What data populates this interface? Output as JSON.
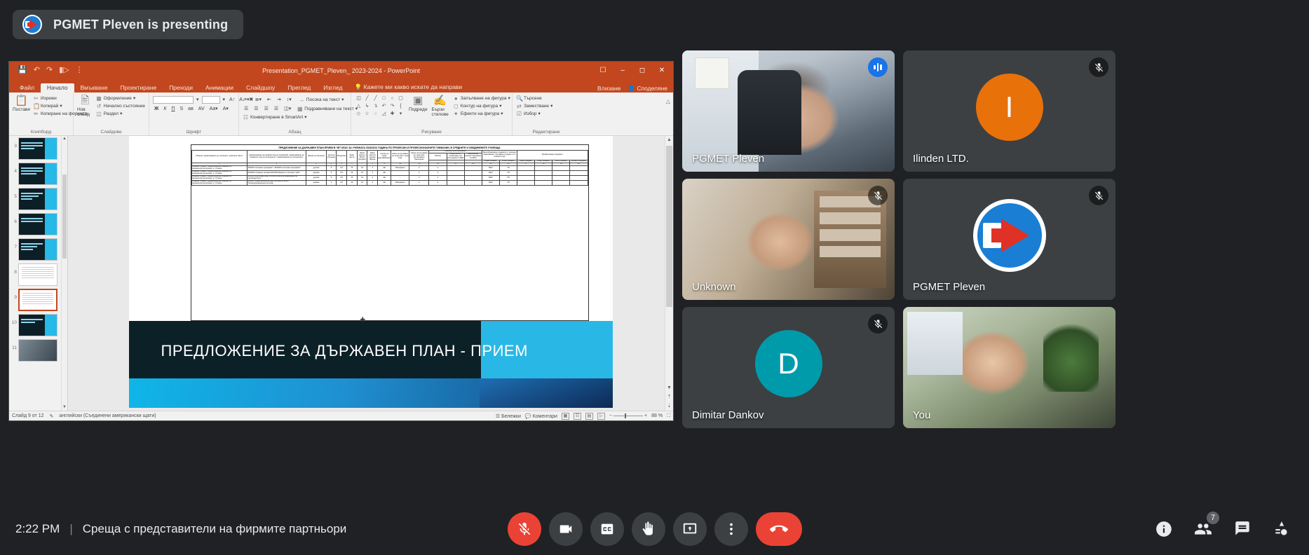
{
  "banner": {
    "text": "PGMET Pleven is presenting",
    "logo_icon": "pgmet-logo-icon"
  },
  "powerpoint": {
    "title": "Presentation_PGMET_Pleven_ 2023-2024 - PowerPoint",
    "quick_access": [
      {
        "name": "save-icon",
        "glyph": "ὋE"
      },
      {
        "name": "undo-icon",
        "glyph": "↶"
      },
      {
        "name": "redo-icon",
        "glyph": "↻"
      },
      {
        "name": "start-slideshow-icon",
        "glyph": "▣"
      },
      {
        "name": "customize-qat-icon",
        "glyph": "☰"
      }
    ],
    "window_buttons": [
      {
        "name": "ribbon-display-options-button",
        "glyph": "❐"
      },
      {
        "name": "minimize-button",
        "glyph": "—"
      },
      {
        "name": "restore-button",
        "glyph": "❐"
      },
      {
        "name": "close-button",
        "glyph": "✕"
      }
    ],
    "tabs": [
      {
        "label": "Файл",
        "active": false
      },
      {
        "label": "Начало",
        "active": true
      },
      {
        "label": "Вмъкване",
        "active": false
      },
      {
        "label": "Проектиране",
        "active": false
      },
      {
        "label": "Преходи",
        "active": false
      },
      {
        "label": "Анимации",
        "active": false
      },
      {
        "label": "Слайдшоу",
        "active": false
      },
      {
        "label": "Преглед",
        "active": false
      },
      {
        "label": "Изглед",
        "active": false
      }
    ],
    "tell_me": "Кажете ми какво искате да направи",
    "tab_right": [
      {
        "label": "Влизане"
      },
      {
        "label": "Споделяне"
      }
    ],
    "ribbon_groups": [
      {
        "label": "Клипборд",
        "big": {
          "label": "Поставя",
          "icon": "paste-icon"
        },
        "items": [
          {
            "label": "Изрежи",
            "icon": "cut-icon"
          },
          {
            "label": "Копирай",
            "icon": "copy-icon"
          },
          {
            "label": "Копиране на форматu",
            "icon": "format-painter-icon"
          }
        ]
      },
      {
        "label": "Слайдове",
        "big": {
          "label": "Нов слайд",
          "icon": "new-slide-icon"
        },
        "items": [
          {
            "label": "Оформление",
            "icon": "layout-icon"
          },
          {
            "label": "Начално състояние",
            "icon": "reset-icon"
          },
          {
            "label": "Раздел",
            "icon": "section-icon"
          }
        ]
      },
      {
        "label": "Шрифт",
        "font_name": "",
        "font_size": "",
        "buttons": [
          "Ж",
          "К",
          "П",
          "S",
          "ав",
          "AV",
          "Aa",
          "A"
        ]
      },
      {
        "label": "Абзац",
        "items": [
          {
            "label": "Посока на текст",
            "icon": "text-direction-icon"
          },
          {
            "label": "Подравняване на текст",
            "icon": "align-text-icon"
          },
          {
            "label": "Конвертиране в SmartArt",
            "icon": "smartart-icon"
          }
        ]
      },
      {
        "label": "Рисуване",
        "items": [
          {
            "label": "Запълване на фигура",
            "icon": "shape-fill-icon"
          },
          {
            "label": "Контур на фигура",
            "icon": "shape-outline-icon"
          },
          {
            "label": "Ефекти на фигура",
            "icon": "shape-effects-icon"
          }
        ],
        "buttons": [
          {
            "label": "Подреди",
            "icon": "arrange-icon"
          },
          {
            "label": "Бързи стилове",
            "icon": "quick-styles-icon"
          }
        ]
      },
      {
        "label": "Редактиране",
        "items": [
          {
            "label": "Търсене",
            "icon": "find-icon"
          },
          {
            "label": "Заместване",
            "icon": "replace-icon"
          },
          {
            "label": "Избор",
            "icon": "select-icon"
          }
        ]
      }
    ],
    "thumbnails": [
      {
        "num": "3",
        "type": "title",
        "selected": false
      },
      {
        "num": "4",
        "type": "title",
        "selected": false
      },
      {
        "num": "5",
        "type": "title",
        "selected": false
      },
      {
        "num": "6",
        "type": "title",
        "selected": false
      },
      {
        "num": "7",
        "type": "title",
        "selected": false
      },
      {
        "num": "8",
        "type": "table",
        "selected": false
      },
      {
        "num": "9",
        "type": "table",
        "selected": true
      },
      {
        "num": "10",
        "type": "table",
        "selected": false
      },
      {
        "num": "11",
        "type": "photo",
        "selected": false
      }
    ],
    "slide": {
      "table_title": "ПРЕДЛОЖЕНИЕ ЗА ДЪРЖАВЕН ПЛАН-ПРИЕМ В ЧЕТ КЛАС ЗА УЧЕБНАТА 2023/2024 ГОДИНА ПО ПРОФЕСИИ И ПРОФЕСИОНАЛНИТЕ ГИМНАЗИИ, В СРЕДНИТЕ И ОБЕДИНЕНИТЕ УЧИЛИЩА",
      "headers_row1": [
        "Община, наименование на училището, населено място",
        "Наименование на профила\nКод на профила/К. наименование на професия;\nКод на специалност; наименование на специалност",
        "Форма на обучение",
        "Срок на обучение",
        "Вход/ниво",
        "Брой места",
        "Брой места в ЗПОО (профил)",
        "Брой места в дуална форма",
        "Степен на проф. квалификация",
        "Ниво на изучаване на чужд език / чужд език",
        "Начин на изучаване на чужд език, Интензивно/ Разширено",
        "Нива на балообразуване",
        "Балообразуващи предмети от основно образование, изучавани в раздел А от учебния план",
        "Профилиращи предмети"
      ],
      "headers_row2": [
        "Избили",
        "Резултати от олимпиади или състезания по БЕЛ",
        "Национално външно оценяване по МОН",
        "първи предмет",
        "втори предмет",
        "първи предмет",
        "втори предмет",
        "трети предмет",
        "четвърти предмет"
      ],
      "col_numbers": [
        "1",
        "2",
        "3",
        "4",
        "5",
        "6",
        "7",
        "8",
        "9",
        "10",
        "11",
        "12",
        "13",
        "14",
        "15",
        "16",
        "17",
        "18",
        "19",
        "20",
        "21",
        "22"
      ],
      "rows": [
        {
          "school": "община Плевен,\nПрофесионална гимназия по механоелектротехника,\nгр. Плевен",
          "profession": "481020 Системен програмист /\n4810201 Системен програмист",
          "form": "дуална",
          "years": "5",
          "entry": "0,5",
          "c6": "13",
          "c7": "13",
          "c8": "3",
          "qual": "АЕ",
          "lang": "Разширено",
          "n1": "2",
          "n2": "2",
          "b1": "БЕЛ",
          "b2": "ТП"
        },
        {
          "school": "община Плевен,\nПрофесионална гимназия по механоелектротехника,\nгр. Плевен",
          "profession": "5230101 Охранна техника\n5230105 Машини и системи с ЦПУ",
          "form": "дуална",
          "years": "5",
          "entry": "0,5",
          "c6": "13",
          "c7": "13",
          "c8": "3",
          "qual": "АЕ",
          "lang": "-",
          "n1": "2",
          "n2": "2",
          "b1": "БЕЛ",
          "b2": "ТП"
        },
        {
          "school": "община Плевен,\nПрофесионална гимназия по механоелектротехника,\nгр. Плевен",
          "profession": "522010 Електромонтьор\n5220204 Електрообзавеждане на производството",
          "form": "дуална",
          "years": "5",
          "entry": "0,5",
          "c6": "13",
          "c7": "13",
          "c8": "3",
          "qual": "АЕ",
          "lang": "-",
          "n1": "2",
          "n2": "2",
          "b1": "БЕЛ",
          "b2": "ТП"
        },
        {
          "school": "община Плевен,\nПрофесионална гимназия по механоелектротехника,\nгр. Плевен",
          "profession": "523050 Техник на компютърни системи\n5230501 Телекомуникационни системи",
          "form": "дневна",
          "years": "5",
          "entry": "0,5",
          "c6": "13",
          "c7": "13",
          "c8": "3",
          "qual": "АЕ",
          "lang": "Разширено",
          "n1": "2",
          "n2": "2",
          "b1": "БЕЛ",
          "b2": "ТП"
        }
      ],
      "banner_text": "ПРЕДЛОЖЕНИЕ ЗА ДЪРЖАВЕН ПЛАН - ПРИЕМ"
    },
    "status": {
      "slide_counter": "Слайд 9 от 12",
      "spellcheck_icon": "spellcheck-icon",
      "language": "английски (Съединени американски щати)",
      "notes_label": "Бележки",
      "comments_label": "Коментари",
      "zoom_level": "88 %",
      "view_buttons": [
        "normal-view-icon",
        "slide-sorter-icon",
        "reading-view-icon",
        "slideshow-icon"
      ]
    }
  },
  "tiles": [
    {
      "name": "PGMET Pleven",
      "kind": "video",
      "speaking": true,
      "mic_state": "active",
      "cam_class": "cam1"
    },
    {
      "name": "Ilinden LTD.",
      "kind": "avatar",
      "avatar_letter": "I",
      "avatar_color": "#e8710a",
      "speaking": false,
      "mic_state": "muted"
    },
    {
      "name": "Unknown",
      "kind": "video",
      "speaking": false,
      "mic_state": "muted",
      "cam_class": "cam2"
    },
    {
      "name": "PGMET Pleven",
      "kind": "logo",
      "speaking": false,
      "mic_state": "muted"
    },
    {
      "name": "Dimitar Dankov",
      "kind": "avatar",
      "avatar_letter": "D",
      "avatar_color": "#009bab",
      "speaking": false,
      "mic_state": "muted"
    },
    {
      "name": "You",
      "kind": "video",
      "speaking": false,
      "mic_state": "none",
      "cam_class": "cam3"
    }
  ],
  "meet_bar": {
    "time": "2:22 PM",
    "separator": "|",
    "meeting_title": "Среща с представители на фирмите партньори",
    "controls": [
      {
        "name": "microphone-off-button",
        "state": "muted",
        "icon": "mic-off-icon"
      },
      {
        "name": "camera-button",
        "state": "on",
        "icon": "camera-icon"
      },
      {
        "name": "captions-button",
        "state": "off",
        "icon": "closed-captions-icon"
      },
      {
        "name": "raise-hand-button",
        "state": "off",
        "icon": "hand-icon"
      },
      {
        "name": "present-now-button",
        "state": "on",
        "icon": "present-screen-icon"
      },
      {
        "name": "more-options-button",
        "state": "off",
        "icon": "more-vert-icon"
      },
      {
        "name": "leave-call-button",
        "state": "danger",
        "icon": "end-call-icon"
      }
    ],
    "right_icons": [
      {
        "name": "meeting-details-button",
        "icon": "info-icon",
        "badge": ""
      },
      {
        "name": "participants-button",
        "icon": "people-icon",
        "badge": "7"
      },
      {
        "name": "chat-button",
        "icon": "chat-icon",
        "badge": ""
      },
      {
        "name": "activities-button",
        "icon": "activities-icon",
        "badge": ""
      }
    ]
  },
  "colors": {
    "accent_blue": "#8ab4f8",
    "ppt_orange": "#c2471e",
    "danger_red": "#ea4335",
    "meet_bg": "#202124",
    "tile_bg": "#3c4043"
  }
}
